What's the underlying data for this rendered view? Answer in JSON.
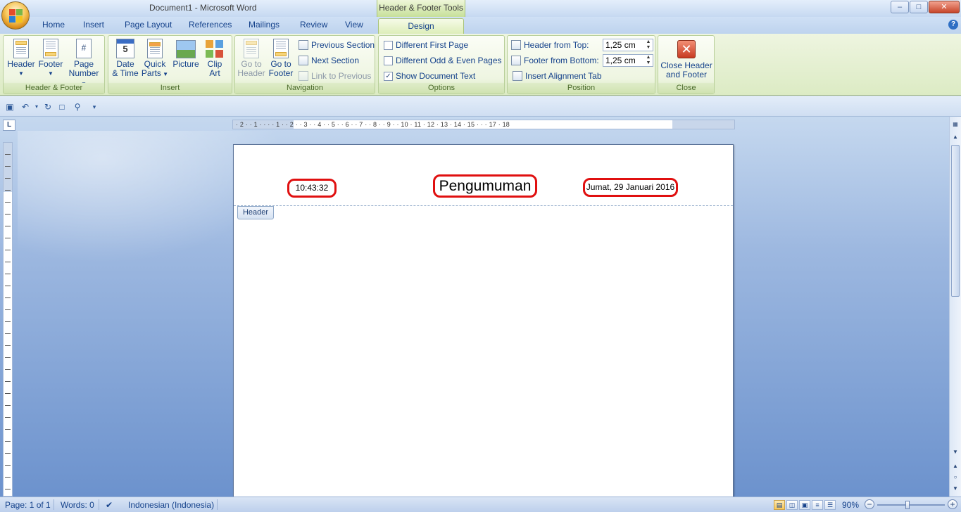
{
  "window": {
    "title": "Document1 - Microsoft Word",
    "contextual_tools": "Header & Footer Tools",
    "controls": [
      "–",
      "□",
      "✕"
    ]
  },
  "tabs": [
    "Home",
    "Insert",
    "Page Layout",
    "References",
    "Mailings",
    "Review",
    "View",
    "Design"
  ],
  "ribbon": {
    "hf_group": {
      "label": "Header & Footer",
      "header": "Header",
      "footer": "Footer",
      "page_number_1": "Page",
      "page_number_2": "Number"
    },
    "insert_group": {
      "label": "Insert",
      "datetime_1": "Date",
      "datetime_2": "& Time",
      "quickparts_1": "Quick",
      "quickparts_2": "Parts",
      "picture": "Picture",
      "clipart_1": "Clip",
      "clipart_2": "Art"
    },
    "nav_group": {
      "label": "Navigation",
      "goto_header_1": "Go to",
      "goto_header_2": "Header",
      "goto_footer_1": "Go to",
      "goto_footer_2": "Footer",
      "prev_section": "Previous Section",
      "next_section": "Next Section",
      "link_prev": "Link to Previous"
    },
    "options_group": {
      "label": "Options",
      "diff_first": "Different First Page",
      "diff_odd_even": "Different Odd & Even Pages",
      "show_text": "Show Document Text"
    },
    "position_group": {
      "label": "Position",
      "header_top_label": "Header from Top:",
      "header_top_value": "1,25 cm",
      "footer_bottom_label": "Footer from Bottom:",
      "footer_bottom_value": "1,25 cm",
      "align_tab": "Insert Alignment Tab"
    },
    "close_group": {
      "label": "Close",
      "close_1": "Close Header",
      "close_2": "and Footer"
    }
  },
  "ruler": {
    "h_numbers": "· 2 · · 1 · · · · 1 · · 2 · · 3 · · 4 · · 5 · · 6 · · 7 · · 8 · · 9 · · 10 · 11 · 12 · 13 · 14 · 15 · · · 17 · 18",
    "corner": "L"
  },
  "document": {
    "header_tag": "Header",
    "time": "10:43:32",
    "title": "Pengumuman",
    "date": "Jumat, 29 Januari 2016"
  },
  "status": {
    "page": "Page: 1 of 1",
    "words": "Words: 0",
    "language": "Indonesian (Indonesia)",
    "zoom": "90%",
    "zoom_minus": "−",
    "zoom_plus": "+"
  }
}
